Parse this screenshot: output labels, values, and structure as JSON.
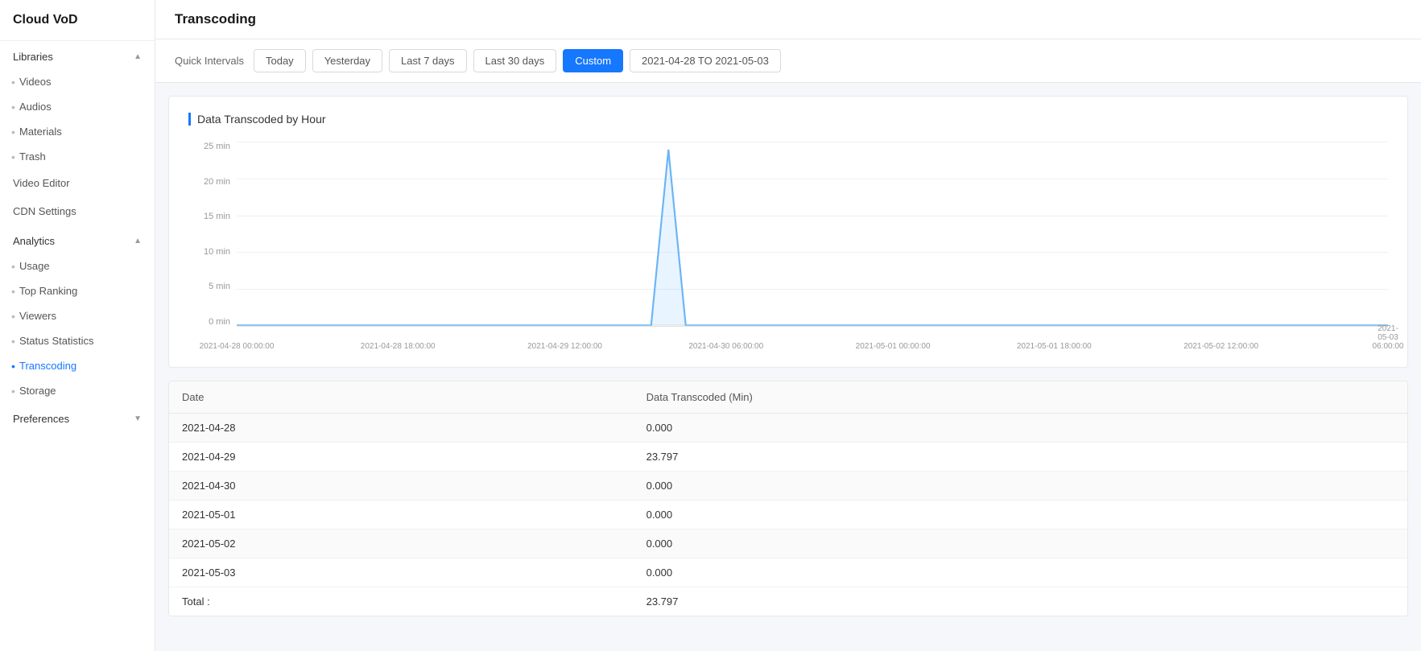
{
  "app": {
    "title": "Cloud VoD"
  },
  "sidebar": {
    "libraries_label": "Libraries",
    "libraries_items": [
      {
        "id": "videos",
        "label": "Videos"
      },
      {
        "id": "audios",
        "label": "Audios"
      },
      {
        "id": "materials",
        "label": "Materials"
      },
      {
        "id": "trash",
        "label": "Trash"
      }
    ],
    "video_editor_label": "Video Editor",
    "cdn_settings_label": "CDN Settings",
    "analytics_label": "Analytics",
    "analytics_items": [
      {
        "id": "usage",
        "label": "Usage"
      },
      {
        "id": "top-ranking",
        "label": "Top Ranking"
      },
      {
        "id": "viewers",
        "label": "Viewers"
      },
      {
        "id": "status-statistics",
        "label": "Status Statistics"
      },
      {
        "id": "transcoding",
        "label": "Transcoding",
        "active": true
      },
      {
        "id": "storage",
        "label": "Storage"
      }
    ],
    "preferences_label": "Preferences"
  },
  "toolbar": {
    "quick_intervals_label": "Quick Intervals",
    "today_label": "Today",
    "yesterday_label": "Yesterday",
    "last7_label": "Last 7 days",
    "last30_label": "Last 30 days",
    "custom_label": "Custom",
    "date_range_label": "2021-04-28 TO 2021-05-03"
  },
  "chart": {
    "title": "Data Transcoded by Hour",
    "y_labels": [
      "25 min",
      "20 min",
      "15 min",
      "10 min",
      "5 min",
      "0 min"
    ],
    "x_labels": [
      "2021-04-28 00:00:00",
      "2021-04-28 18:00:00",
      "2021-04-29 12:00:00",
      "2021-04-30 06:00:00",
      "2021-05-01 00:00:00",
      "2021-05-01 18:00:00",
      "2021-05-02 12:00:00",
      "2021-05-03 06:00:00"
    ]
  },
  "table": {
    "col_date": "Date",
    "col_data": "Data Transcoded (Min)",
    "rows": [
      {
        "date": "2021-04-28",
        "value": "0.000",
        "blue": true
      },
      {
        "date": "2021-04-29",
        "value": "23.797",
        "blue": false
      },
      {
        "date": "2021-04-30",
        "value": "0.000",
        "blue": true
      },
      {
        "date": "2021-05-01",
        "value": "0.000",
        "blue": true
      },
      {
        "date": "2021-05-02",
        "value": "0.000",
        "blue": true
      },
      {
        "date": "2021-05-03",
        "value": "0.000",
        "blue": true
      }
    ],
    "total_label": "Total :",
    "total_value": "23.797"
  }
}
